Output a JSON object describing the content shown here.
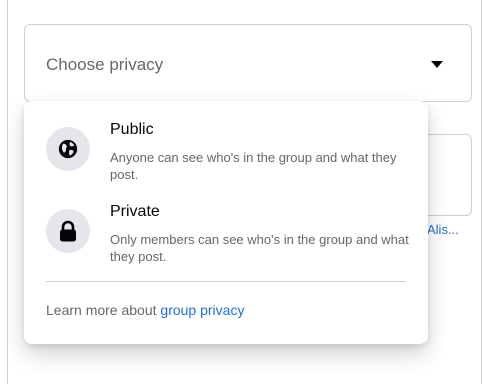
{
  "select": {
    "placeholder": "Choose privacy",
    "caret_icon": "caret-down-icon"
  },
  "background_link": "Alis...",
  "options": [
    {
      "title": "Public",
      "description": "Anyone can see who's in the group and what they post.",
      "icon": "globe-icon"
    },
    {
      "title": "Private",
      "description": "Only members can see who's in the group and what they post.",
      "icon": "lock-icon"
    }
  ],
  "footer": {
    "text": "Learn more about ",
    "link": "group privacy"
  },
  "colors": {
    "text_primary": "#050505",
    "text_secondary": "#65676b",
    "link": "#216fdb",
    "icon_background": "#e4e6eb",
    "border": "#ced0d4"
  }
}
